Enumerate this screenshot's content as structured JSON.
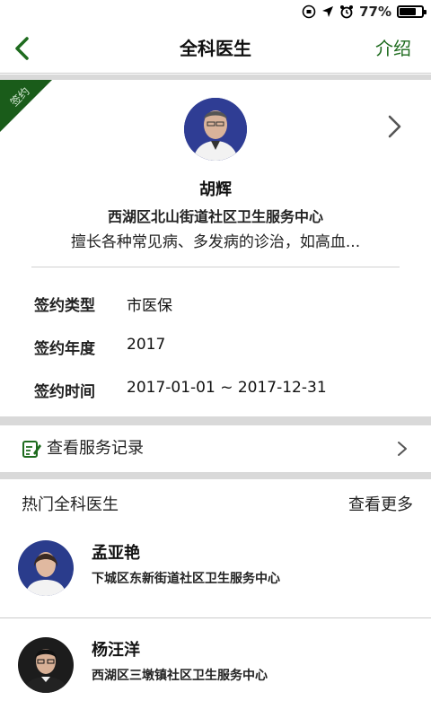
{
  "status_bar": {
    "battery": "77%",
    "battery_level": 0.77
  },
  "nav": {
    "title": "全科医生",
    "right_label": "介绍"
  },
  "signed_doctor": {
    "ribbon_label": "签约",
    "name": "胡辉",
    "organization": "西湖区北山街道社区卫生服务中心",
    "specialty": "擅长各种常见病、多发病的诊治，如高血...",
    "rows": [
      {
        "label": "签约类型",
        "value": "市医保"
      },
      {
        "label": "签约年度",
        "value": "2017"
      },
      {
        "label": "签约时间",
        "value": "2017-01-01 ~ 2017-12-31"
      }
    ]
  },
  "service_record": {
    "label": "查看服务记录"
  },
  "hot_doctors": {
    "title": "热门全科医生",
    "more": "查看更多",
    "items": [
      {
        "name": "孟亚艳",
        "organization": "下城区东新街道社区卫生服务中心"
      },
      {
        "name": "杨汪洋",
        "organization": "西湖区三墩镇社区卫生服务中心"
      }
    ]
  },
  "colors": {
    "accent_green": "#1e6b1e",
    "ribbon_green": "#1a5c1a",
    "divider": "#d9d9d9"
  }
}
